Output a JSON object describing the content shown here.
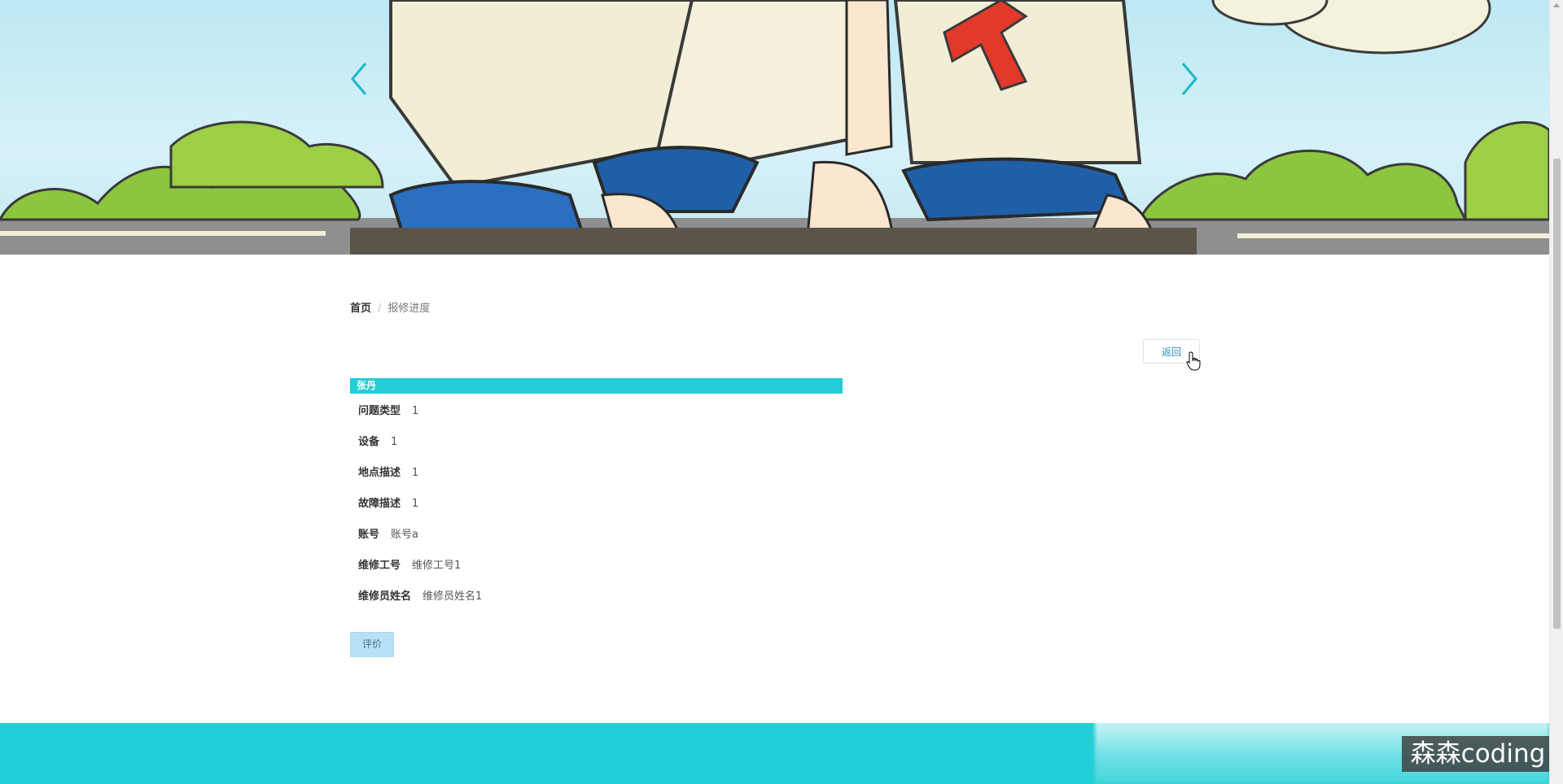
{
  "banner": {
    "prev_icon": "chevron-left-icon",
    "next_icon": "chevron-right-icon"
  },
  "breadcrumb": {
    "home": "首页",
    "separator": "/",
    "current": "报修进度"
  },
  "back_button": {
    "label": "返回"
  },
  "record": {
    "name": "张丹",
    "fields": [
      {
        "label": "问题类型",
        "value": "1"
      },
      {
        "label": "设备",
        "value": "1"
      },
      {
        "label": "地点描述",
        "value": "1"
      },
      {
        "label": "故障描述",
        "value": "1"
      },
      {
        "label": "账号",
        "value": "账号a"
      },
      {
        "label": "维修工号",
        "value": "维修工号1"
      },
      {
        "label": "维修员姓名",
        "value": "维修员姓名1"
      }
    ]
  },
  "rate_button": {
    "label": "评价"
  },
  "watermark": {
    "text": "森森coding"
  },
  "colors": {
    "accent": "#22cdd6",
    "link": "#2a8fbd",
    "rate_button_bg": "#b8e1f5"
  }
}
